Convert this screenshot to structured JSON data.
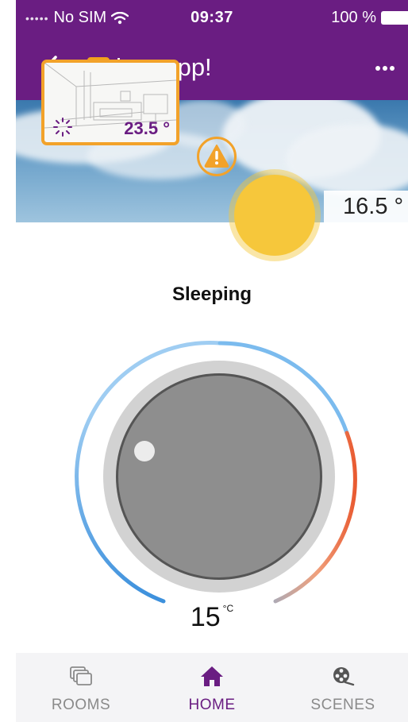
{
  "colors": {
    "brand_purple": "#6a1d82",
    "accent_orange": "#f2a22a",
    "sun_yellow": "#f6c73b",
    "dial_cold": "#3b8fdc",
    "dial_hot": "#e8542a",
    "tab_inactive": "#8a8a8a"
  },
  "status_bar": {
    "carrier": "No SIM",
    "time": "09:37",
    "battery": "100 %"
  },
  "header": {
    "logo_text_top": "heat",
    "logo_text_bottom": "app",
    "title": "heatapp!"
  },
  "hero": {
    "room_temperature": "23.5 °",
    "outdoor_temperature": "16.5 °"
  },
  "thermostat": {
    "mode": "Sleeping",
    "setpoint": "15",
    "unit": "°C"
  },
  "tabs": [
    {
      "label": "ROOMS",
      "icon": "rooms-icon",
      "active": false
    },
    {
      "label": "HOME",
      "icon": "home-icon",
      "active": true
    },
    {
      "label": "SCENES",
      "icon": "film-reel-icon",
      "active": false
    }
  ]
}
